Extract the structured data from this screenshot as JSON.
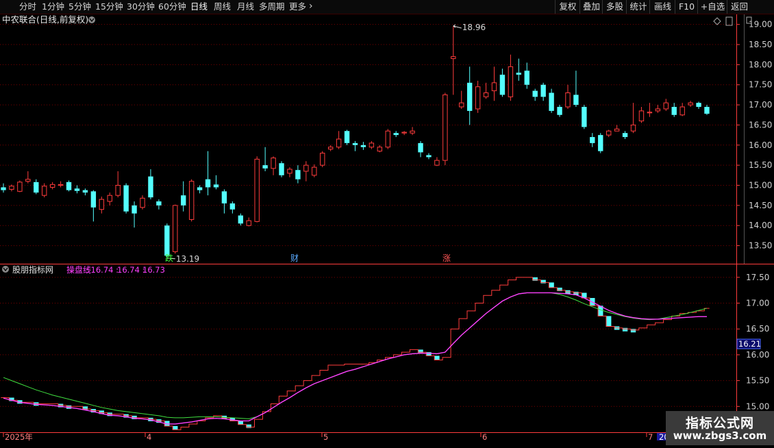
{
  "toolbar": {
    "periods": [
      "分时",
      "1分钟",
      "5分钟",
      "15分钟",
      "30分钟",
      "60分钟",
      "日线",
      "周线",
      "月线",
      "多周期",
      "更多"
    ],
    "active_period": "日线",
    "buttons": [
      "复权",
      "叠加",
      "多股",
      "统计",
      "画线",
      "F10",
      "+自选",
      "返回"
    ]
  },
  "main_panel": {
    "title": "中农联合(日线,前复权)",
    "price_axis_ticks": [
      "19.00",
      "18.50",
      "18.00",
      "17.50",
      "17.00",
      "16.50",
      "16.00",
      "15.50",
      "15.00",
      "14.50",
      "14.00",
      "13.50"
    ],
    "high_label": "18.96",
    "low_label": "13.19",
    "markers": [
      "跌",
      "财",
      "涨"
    ]
  },
  "indicator_panel": {
    "title": "股朋指标网",
    "line_name": "操盘线",
    "values": [
      "16.74",
      "16.74",
      "16.73"
    ],
    "axis_ticks": [
      "17.50",
      "17.00",
      "16.50",
      "16.00",
      "15.50",
      "15.00"
    ],
    "current_value": "16.21"
  },
  "time_axis": {
    "labels": [
      "2025年",
      "4",
      "5",
      "6",
      "7",
      "20"
    ]
  },
  "watermark": {
    "line1": "指标公式网",
    "line2": "www.zbgs3.com"
  },
  "colors": {
    "up": "#ff3c3c",
    "down": "#54ffff",
    "grid": "#7a0000",
    "pink_line": "#ff40ff",
    "green_line": "#40e040"
  },
  "chart_data": {
    "type": "candlestick",
    "ylim": [
      13.05,
      19.25
    ],
    "candles": [
      [
        14.95,
        14.88,
        15.05,
        14.82
      ],
      [
        14.9,
        14.98,
        15.02,
        14.85
      ],
      [
        14.85,
        15.08,
        15.12,
        14.83
      ],
      [
        15.1,
        15.15,
        15.35,
        15.05
      ],
      [
        15.08,
        14.82,
        15.15,
        14.78
      ],
      [
        14.75,
        14.98,
        15.05,
        14.7
      ],
      [
        14.95,
        15.02,
        15.08,
        14.9
      ],
      [
        15.0,
        15.02,
        15.1,
        14.95
      ],
      [
        15.08,
        14.88,
        15.12,
        14.85
      ],
      [
        14.92,
        14.86,
        15.0,
        14.8
      ],
      [
        14.88,
        14.82,
        14.92,
        14.75
      ],
      [
        14.85,
        14.45,
        14.88,
        14.1
      ],
      [
        14.4,
        14.65,
        14.72,
        14.3
      ],
      [
        14.6,
        14.75,
        14.82,
        14.5
      ],
      [
        14.75,
        15.0,
        15.35,
        14.7
      ],
      [
        15.0,
        14.35,
        15.05,
        14.3
      ],
      [
        14.5,
        14.3,
        14.6,
        13.95
      ],
      [
        14.45,
        14.68,
        14.75,
        14.4
      ],
      [
        15.22,
        14.7,
        15.4,
        14.65
      ],
      [
        14.6,
        14.5,
        14.65,
        14.4
      ],
      [
        14.0,
        13.25,
        14.05,
        13.19
      ],
      [
        13.35,
        14.5,
        14.52,
        13.3
      ],
      [
        14.75,
        14.5,
        15.1,
        14.35
      ],
      [
        14.15,
        15.1,
        15.15,
        14.1
      ],
      [
        14.95,
        14.88,
        15.0,
        14.8
      ],
      [
        15.15,
        14.95,
        15.85,
        14.75
      ],
      [
        15.02,
        14.95,
        15.25,
        14.9
      ],
      [
        14.85,
        14.55,
        14.9,
        14.3
      ],
      [
        14.55,
        14.4,
        14.6,
        14.3
      ],
      [
        14.25,
        14.05,
        14.3,
        14.0
      ],
      [
        14.0,
        14.12,
        14.2,
        13.98
      ],
      [
        14.1,
        15.65,
        15.72,
        14.08
      ],
      [
        15.5,
        15.42,
        15.95,
        15.35
      ],
      [
        15.42,
        15.68,
        15.72,
        15.25
      ],
      [
        15.55,
        15.25,
        15.6,
        15.2
      ],
      [
        15.3,
        15.4,
        15.45,
        15.2
      ],
      [
        15.38,
        15.15,
        15.5,
        15.05
      ],
      [
        15.35,
        15.5,
        15.6,
        15.1
      ],
      [
        15.25,
        15.45,
        15.52,
        15.2
      ],
      [
        15.5,
        15.8,
        15.85,
        15.45
      ],
      [
        15.9,
        15.95,
        16.0,
        15.85
      ],
      [
        15.95,
        16.15,
        16.35,
        15.9
      ],
      [
        16.35,
        16.05,
        16.38,
        16.0
      ],
      [
        16.05,
        16.0,
        16.1,
        15.85
      ],
      [
        16.0,
        15.95,
        16.08,
        15.88
      ],
      [
        15.95,
        16.05,
        16.1,
        15.9
      ],
      [
        15.85,
        15.95,
        16.0,
        15.82
      ],
      [
        15.95,
        16.35,
        16.4,
        15.9
      ],
      [
        16.3,
        16.25,
        16.35,
        16.2
      ],
      [
        16.3,
        16.32,
        16.35,
        16.25
      ],
      [
        16.3,
        16.35,
        16.45,
        16.25
      ],
      [
        16.05,
        15.82,
        16.1,
        15.7
      ],
      [
        15.75,
        15.7,
        15.8,
        15.65
      ],
      [
        15.5,
        15.62,
        15.7,
        15.48
      ],
      [
        15.62,
        17.25,
        17.3,
        15.5
      ],
      [
        18.15,
        18.2,
        18.96,
        17.25
      ],
      [
        16.95,
        17.05,
        17.35,
        16.9
      ],
      [
        17.55,
        16.85,
        17.95,
        16.5
      ],
      [
        16.9,
        17.45,
        17.6,
        16.8
      ],
      [
        17.2,
        17.3,
        17.55,
        17.15
      ],
      [
        17.35,
        17.55,
        17.95,
        17.1
      ],
      [
        17.75,
        17.25,
        17.9,
        17.2
      ],
      [
        17.2,
        17.95,
        18.25,
        17.1
      ],
      [
        17.8,
        17.75,
        18.15,
        17.6
      ],
      [
        17.85,
        17.5,
        18.05,
        17.4
      ],
      [
        17.35,
        17.2,
        17.4,
        17.1
      ],
      [
        17.5,
        17.2,
        17.55,
        17.1
      ],
      [
        17.3,
        16.85,
        17.4,
        16.8
      ],
      [
        16.95,
        16.75,
        17.0,
        16.7
      ],
      [
        16.95,
        17.3,
        17.5,
        16.9
      ],
      [
        17.25,
        17.0,
        17.85,
        16.95
      ],
      [
        16.95,
        16.45,
        17.0,
        16.4
      ],
      [
        16.2,
        16.05,
        16.3,
        15.95
      ],
      [
        16.25,
        15.85,
        16.3,
        15.8
      ],
      [
        16.25,
        16.35,
        16.38,
        16.2
      ],
      [
        16.35,
        16.4,
        16.5,
        16.35
      ],
      [
        16.3,
        16.2,
        16.35,
        16.15
      ],
      [
        16.35,
        16.5,
        17.05,
        16.3
      ],
      [
        16.6,
        16.85,
        16.95,
        16.55
      ],
      [
        16.8,
        16.82,
        17.05,
        16.7
      ],
      [
        16.85,
        16.9,
        17.0,
        16.8
      ],
      [
        16.9,
        17.05,
        17.15,
        16.85
      ],
      [
        16.95,
        16.75,
        17.05,
        16.7
      ],
      [
        16.75,
        16.95,
        17.05,
        16.72
      ],
      [
        17.0,
        17.05,
        17.1,
        16.95
      ],
      [
        17.05,
        16.95,
        17.08,
        16.9
      ],
      [
        16.95,
        16.78,
        17.0,
        16.75
      ]
    ],
    "indicator_ylim": [
      14.5,
      17.75
    ],
    "step_line": [
      15.17,
      15.12,
      15.08,
      15.08,
      15.05,
      15.05,
      15.05,
      15.02,
      15.0,
      15.0,
      14.95,
      14.92,
      14.88,
      14.85,
      14.85,
      14.82,
      14.78,
      14.78,
      14.75,
      14.72,
      14.62,
      14.55,
      14.6,
      14.66,
      14.72,
      14.78,
      14.82,
      14.78,
      14.72,
      14.65,
      14.6,
      14.75,
      14.9,
      15.05,
      15.2,
      15.3,
      15.4,
      15.5,
      15.6,
      15.7,
      15.8,
      15.8,
      15.82,
      15.82,
      15.82,
      15.85,
      15.9,
      15.95,
      16.0,
      16.05,
      16.1,
      16.05,
      15.98,
      15.9,
      15.95,
      16.5,
      16.7,
      16.85,
      17.0,
      17.15,
      17.25,
      17.35,
      17.45,
      17.5,
      17.5,
      17.45,
      17.4,
      17.3,
      17.25,
      17.22,
      17.2,
      17.1,
      16.95,
      16.75,
      16.55,
      16.52,
      16.5,
      16.48,
      16.52,
      16.58,
      16.62,
      16.68,
      16.75,
      16.8,
      16.82,
      16.85,
      16.9
    ],
    "pink_line": [
      15.16,
      15.12,
      15.08,
      15.06,
      15.04,
      15.03,
      15.02,
      15.0,
      14.98,
      14.96,
      14.93,
      14.9,
      14.86,
      14.83,
      14.82,
      14.8,
      14.77,
      14.76,
      14.74,
      14.7,
      14.66,
      14.66,
      14.68,
      14.7,
      14.73,
      14.76,
      14.77,
      14.76,
      14.74,
      14.72,
      14.72,
      14.8,
      14.88,
      14.98,
      15.08,
      15.17,
      15.27,
      15.36,
      15.44,
      15.5,
      15.56,
      15.62,
      15.68,
      15.72,
      15.77,
      15.82,
      15.87,
      15.92,
      15.96,
      16.0,
      16.02,
      16.03,
      16.03,
      16.02,
      16.05,
      16.22,
      16.38,
      16.52,
      16.66,
      16.8,
      16.92,
      17.04,
      17.12,
      17.18,
      17.2,
      17.2,
      17.2,
      17.2,
      17.19,
      17.18,
      17.16,
      17.1,
      17.02,
      16.94,
      16.86,
      16.8,
      16.75,
      16.72,
      16.7,
      16.69,
      16.69,
      16.7,
      16.71,
      16.72,
      16.73,
      16.74,
      16.74
    ],
    "green_line": [
      15.56,
      15.5,
      15.44,
      15.38,
      15.32,
      15.27,
      15.22,
      15.18,
      15.14,
      15.1,
      15.06,
      15.02,
      14.98,
      14.95,
      14.92,
      14.9,
      14.88,
      14.86,
      14.84,
      14.82,
      14.79,
      14.78,
      14.78,
      14.79,
      14.8,
      14.8,
      14.8,
      14.79,
      14.78,
      14.77,
      14.76,
      14.8,
      14.88,
      14.98,
      15.08,
      15.17,
      15.27,
      15.36,
      15.44,
      15.5,
      15.56,
      15.62,
      15.68,
      15.72,
      15.77,
      15.82,
      15.87,
      15.92,
      15.96,
      16.0,
      16.02,
      16.03,
      16.03,
      16.02,
      16.05,
      16.22,
      16.38,
      16.52,
      16.66,
      16.8,
      16.92,
      17.04,
      17.12,
      17.18,
      17.2,
      17.2,
      17.2,
      17.2,
      17.17,
      17.12,
      17.06,
      16.99,
      16.93,
      16.87,
      16.82,
      16.78,
      16.74,
      16.71,
      16.69,
      16.68,
      16.69,
      16.72,
      16.75,
      16.78,
      16.82,
      16.86,
      16.9
    ]
  }
}
